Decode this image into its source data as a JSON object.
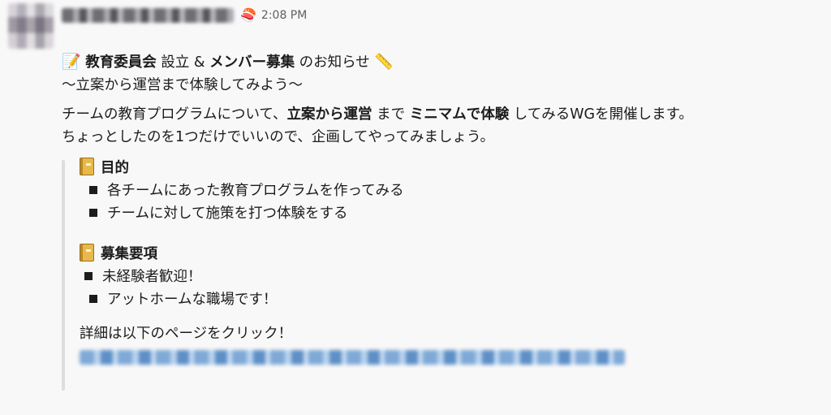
{
  "message": {
    "status_emoji": "🍣",
    "timestamp": "2:08 PM",
    "title_line": {
      "emoji": "📝",
      "part1_bold": "教育委員会",
      "part2": " 設立 & ",
      "part3_bold": "メンバー募集",
      "part4": " のお知らせ ",
      "end_emoji": "📏"
    },
    "subtitle": "〜立案から運営まで体験してみよう〜",
    "intro_line1": {
      "part1": "チームの教育プログラムについて、",
      "part2_bold": "立案から運営",
      "part3": " まで ",
      "part4_bold": "ミニマムで体験",
      "part5": " してみるWGを開催します。"
    },
    "intro_line2": "ちょっとしたのを1つだけでいいので、企画してやってみましょう。",
    "purpose": {
      "heading": "目的",
      "items": [
        "各チームにあった教育プログラムを作ってみる",
        "チームに対して施策を打つ体験をする"
      ]
    },
    "recruitment": {
      "heading": "募集要項",
      "items": [
        "未経験者歓迎！",
        "アットホームな職場です！"
      ]
    },
    "details_text": "詳細は以下のページをクリック！"
  }
}
